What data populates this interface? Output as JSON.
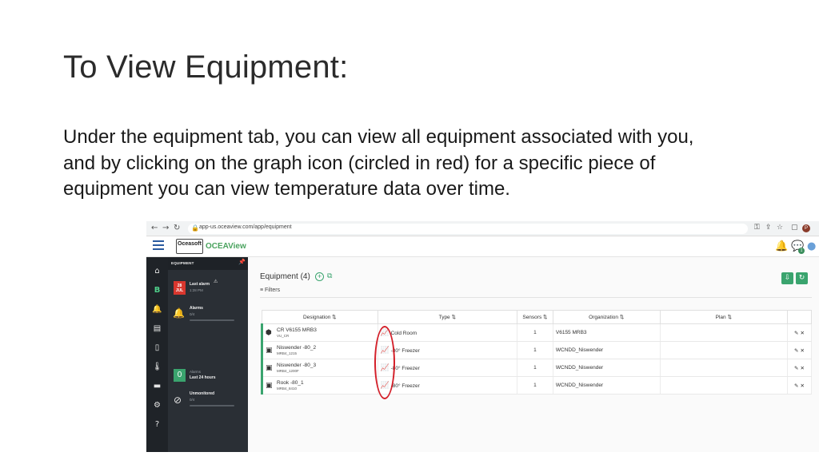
{
  "slide": {
    "title": "To View Equipment:",
    "body": "Under the equipment tab, you can view all equipment associated with you, and by clicking on the graph icon (circled in red) for a specific piece of equipment you can view temperature data over time."
  },
  "browser": {
    "url": "app-us.oceaview.com/app/equipment",
    "profile_initial": "P"
  },
  "app": {
    "logo_box": "Oceasoft",
    "logo_name": "OCEAView",
    "header_badge": "1"
  },
  "panel": {
    "header": "EQUIPMENT",
    "date_day": "28",
    "date_month": "JUL",
    "last_alarm_label": "Last alarm",
    "last_alarm_time": "1:28 PM",
    "alarms_label": "Alarms",
    "alarms_count": "0/4",
    "zero_value": "0",
    "alarms_24_label": "Alarms",
    "last_24_label": "Last 24 hours",
    "unmonitored_label": "Unmonitored",
    "unmonitored_count": "0/4"
  },
  "main": {
    "title": "Equipment (4)",
    "filters_label": "Filters",
    "columns": {
      "designation": "Designation",
      "type": "Type",
      "sensors": "Sensors",
      "organization": "Organization",
      "plan": "Plan"
    },
    "rows": [
      {
        "name": "CR V6155 MRB3",
        "code": "VU_CR",
        "type": "Cold Room",
        "sensors": "1",
        "organization": "V6155 MRB3"
      },
      {
        "name": "Niswender -80_2",
        "code": "MRB4_1215",
        "type": "-80° Freezer",
        "sensors": "1",
        "organization": "WCNDD_Niswender"
      },
      {
        "name": "Niswender -80_3",
        "code": "MRB4_1200F",
        "type": "-80° Freezer",
        "sensors": "1",
        "organization": "WCNDD_Niswender"
      },
      {
        "name": "Rook -80_1",
        "code": "MRB4_8410",
        "type": "-80° Freezer",
        "sensors": "1",
        "organization": "WCNDD_Niswender"
      }
    ]
  },
  "colors": {
    "accent": "#3aa46e",
    "highlight": "#d4202a",
    "sidebar": "#1f2328"
  }
}
